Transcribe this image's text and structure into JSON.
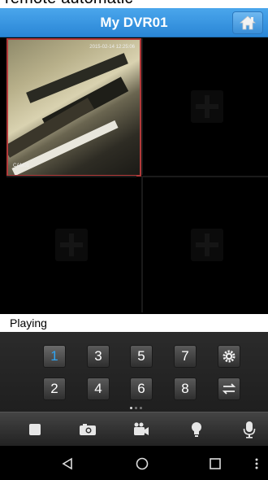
{
  "top_caption": "remote automatic",
  "header": {
    "title": "My DVR01",
    "home_icon": "home-icon"
  },
  "channels": [
    {
      "label": "CAM01",
      "timestamp": "2015-02-14 12:25:06"
    },
    {
      "label": ""
    },
    {
      "label": ""
    },
    {
      "label": ""
    }
  ],
  "status": {
    "text": "Playing"
  },
  "channel_buttons": [
    "1",
    "2",
    "3",
    "4",
    "5",
    "6",
    "7",
    "8"
  ],
  "active_channel": "1",
  "page_indicator": {
    "current": 1,
    "total": 3
  },
  "toolbar": {
    "items": [
      "stop-icon",
      "snapshot-icon",
      "record-icon",
      "light-icon",
      "microphone-icon"
    ]
  },
  "android_nav": [
    "back-icon",
    "home-circle-icon",
    "recents-icon",
    "more-icon"
  ],
  "colors": {
    "header_blue": "#3796e1",
    "active_channel": "#2fa4f2",
    "selected_border": "#b33a3a"
  }
}
